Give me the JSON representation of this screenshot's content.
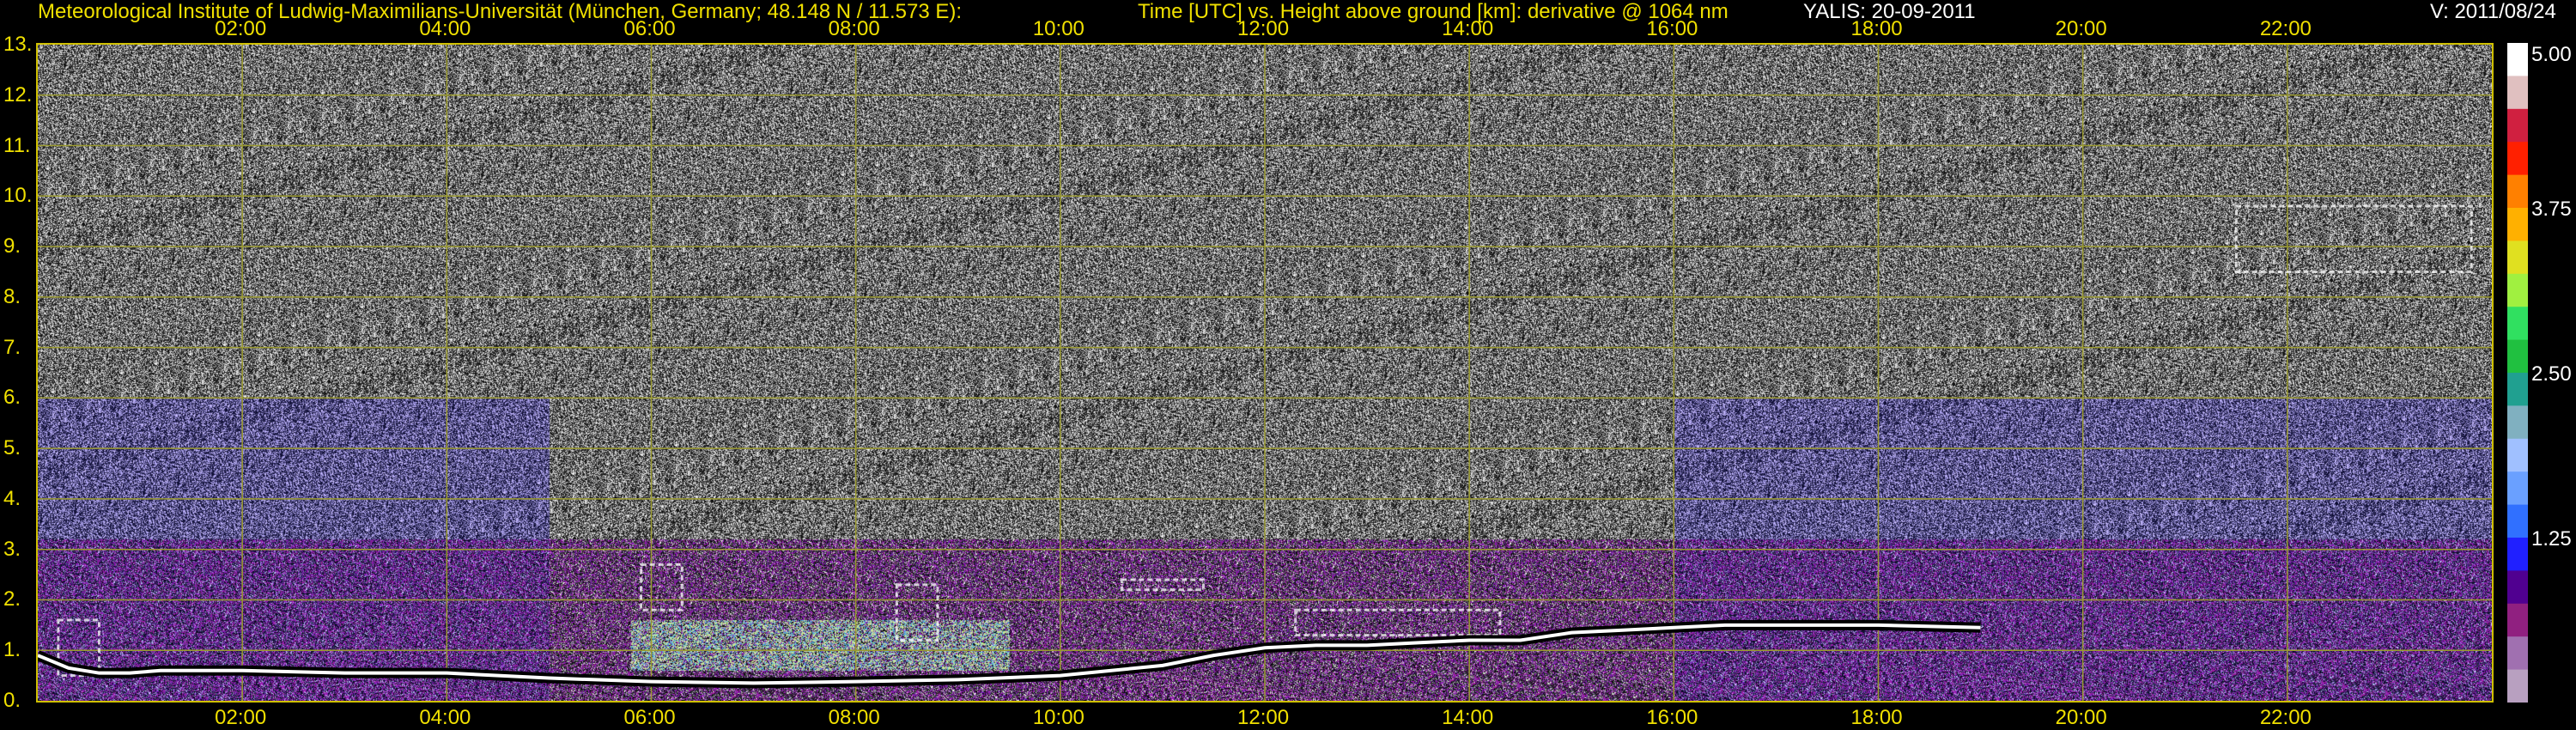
{
  "header": {
    "institute": "Meteorological Institute of Ludwig-Maximilians-Universität (München, Germany; 48.148 N / 11.573 E):",
    "title": "Time [UTC] vs. Height above ground [km]: derivative @ 1064 nm",
    "instrument": "YALIS: 20-09-2011",
    "version": "V: 2011/08/24"
  },
  "colors": {
    "axis_text": "#f0e000",
    "frame": "#d0c000",
    "grid": "#9a9a30",
    "layer_line": "#ffffff",
    "background": "#000000"
  },
  "chart_data": {
    "type": "heatmap",
    "title": "Time [UTC] vs. Height above ground [km]: derivative @ 1064 nm",
    "x_ticks": [
      "02:00",
      "04:00",
      "06:00",
      "08:00",
      "10:00",
      "12:00",
      "14:00",
      "16:00",
      "18:00",
      "20:00",
      "22:00"
    ],
    "x_tick_hours": [
      2,
      4,
      6,
      8,
      10,
      12,
      14,
      16,
      18,
      20,
      22
    ],
    "xlim_hours": [
      0,
      24
    ],
    "y_ticks": [
      "0.",
      "1.",
      "2.",
      "3.",
      "4.",
      "5.",
      "6.",
      "7.",
      "8.",
      "9.",
      "10.",
      "11.",
      "12.",
      "13."
    ],
    "y_tick_values": [
      0,
      1,
      2,
      3,
      4,
      5,
      6,
      7,
      8,
      9,
      10,
      11,
      12,
      13
    ],
    "ylim_km": [
      0,
      13
    ],
    "grid": true,
    "colorbar": {
      "labels": [
        "5.00",
        "3.75",
        "2.50",
        "1.25"
      ],
      "values": [
        5.0,
        3.75,
        2.5,
        1.25
      ],
      "range": [
        0,
        5
      ],
      "colors": [
        "#b8a0c0",
        "#a070b0",
        "#902080",
        "#500090",
        "#2020ff",
        "#3070ff",
        "#6aa0ff",
        "#a0c0ff",
        "#80b0c0",
        "#20a090",
        "#20c040",
        "#30e060",
        "#a0f040",
        "#e0e020",
        "#ffb000",
        "#ff8000",
        "#ff2000",
        "#d02040",
        "#e0c0c0",
        "#ffffff"
      ]
    },
    "layer_top": {
      "name": "aerosol layer top",
      "x_hours": [
        0.0,
        0.3,
        0.6,
        0.9,
        1.2,
        2.0,
        3.0,
        4.0,
        5.0,
        6.0,
        7.0,
        8.0,
        9.0,
        10.0,
        10.5,
        11.0,
        11.5,
        12.0,
        12.5,
        13.0,
        13.5,
        14.0,
        14.5,
        15.0,
        15.5,
        16.0,
        16.5,
        17.0,
        18.0,
        19.0
      ],
      "height_km": [
        0.9,
        0.65,
        0.55,
        0.55,
        0.6,
        0.6,
        0.55,
        0.55,
        0.45,
        0.38,
        0.35,
        0.38,
        0.42,
        0.5,
        0.6,
        0.7,
        0.9,
        1.05,
        1.1,
        1.1,
        1.15,
        1.2,
        1.2,
        1.35,
        1.4,
        1.45,
        1.5,
        1.5,
        1.5,
        1.45
      ]
    },
    "cloud_patches": [
      {
        "x_hours": [
          0.2,
          0.6
        ],
        "height_km": [
          0.5,
          1.6
        ]
      },
      {
        "x_hours": [
          5.9,
          6.3
        ],
        "height_km": [
          1.8,
          2.7
        ]
      },
      {
        "x_hours": [
          8.4,
          8.8
        ],
        "height_km": [
          1.2,
          2.3
        ]
      },
      {
        "x_hours": [
          10.6,
          11.4
        ],
        "height_km": [
          2.2,
          2.4
        ]
      },
      {
        "x_hours": [
          12.3,
          14.3
        ],
        "height_km": [
          1.3,
          1.8
        ]
      },
      {
        "x_hours": [
          21.5,
          23.8
        ],
        "height_km": [
          8.5,
          9.8
        ]
      }
    ]
  }
}
